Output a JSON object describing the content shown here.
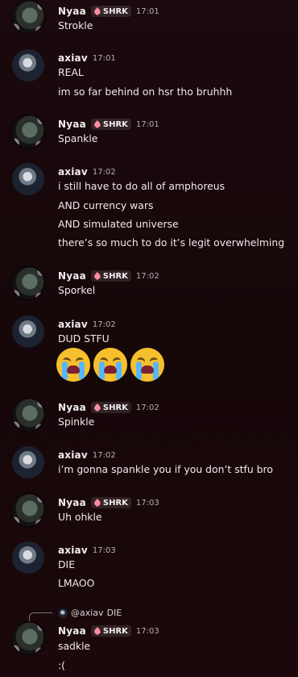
{
  "messages": [
    {
      "author": "Nyaa",
      "tag": "SHRK",
      "time": "17:01",
      "lines": [
        "Strokle"
      ]
    },
    {
      "author": "axiav",
      "time": "17:01",
      "lines": [
        "REAL",
        "im so far behind on hsr tho bruhhh"
      ]
    },
    {
      "author": "Nyaa",
      "tag": "SHRK",
      "time": "17:01",
      "lines": [
        "Spankle"
      ]
    },
    {
      "author": "axiav",
      "time": "17:02",
      "lines": [
        "i still have to do all of amphoreus",
        "AND currency wars",
        "AND simulated universe",
        "there’s so much to do it’s legit overwhelming"
      ]
    },
    {
      "author": "Nyaa",
      "tag": "SHRK",
      "time": "17:02",
      "lines": [
        "Sporkel"
      ]
    },
    {
      "author": "axiav",
      "time": "17:02",
      "lines": [
        "DUD STFU"
      ],
      "emojis": [
        "loudly-crying-face",
        "loudly-crying-face",
        "loudly-crying-face"
      ]
    },
    {
      "author": "Nyaa",
      "tag": "SHRK",
      "time": "17:02",
      "lines": [
        "Spinkle"
      ]
    },
    {
      "author": "axiav",
      "time": "17:02",
      "lines": [
        "i’m gonna spankle you if you don’t stfu bro"
      ]
    },
    {
      "author": "Nyaa",
      "tag": "SHRK",
      "time": "17:03",
      "lines": [
        "Uh ohkle"
      ]
    },
    {
      "author": "axiav",
      "time": "17:03",
      "lines": [
        "DIE",
        "LMAOO"
      ]
    },
    {
      "author": "Nyaa",
      "tag": "SHRK",
      "time": "17:03",
      "reply": {
        "author": "@axiav",
        "text": "DIE"
      },
      "lines": [
        "sadkle",
        ":("
      ]
    }
  ]
}
